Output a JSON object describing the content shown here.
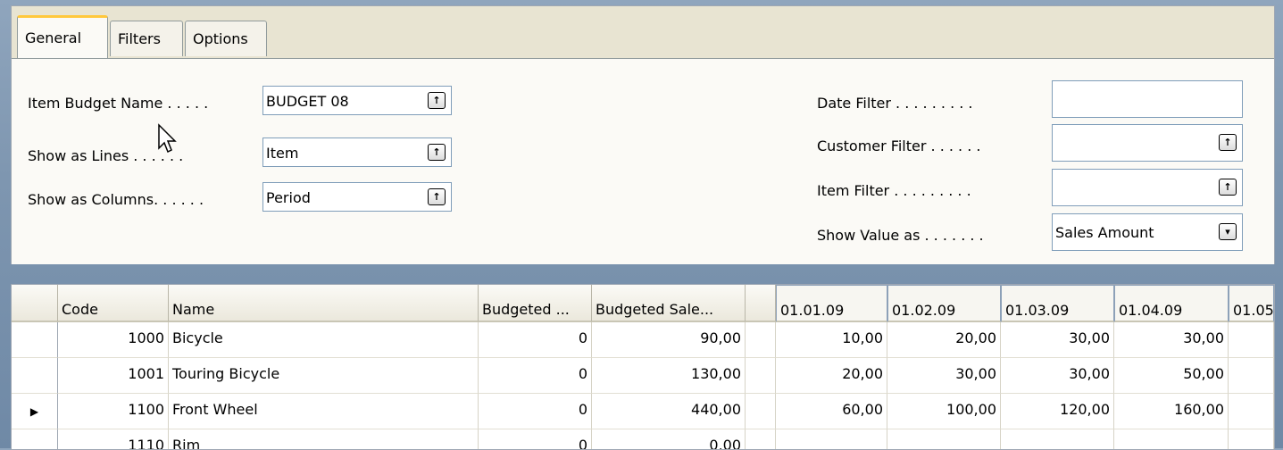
{
  "tabs": [
    "General",
    "Filters",
    "Options"
  ],
  "form": {
    "item_budget_name_label": "Item Budget Name . . . . .",
    "item_budget_name_value": "BUDGET 08",
    "show_as_lines_label": "Show as Lines . . . . . .",
    "show_as_lines_value": "Item",
    "show_as_columns_label": "Show as Columns. . . . . .",
    "show_as_columns_value": "Period",
    "date_filter_label": "Date Filter . . . . . . . . .",
    "date_filter_value": "",
    "customer_filter_label": "Customer Filter . . . . . .",
    "customer_filter_value": "",
    "item_filter_label": "Item Filter . . . . . . . . .",
    "item_filter_value": "",
    "show_value_as_label": "Show Value as . . . . . . .",
    "show_value_as_value": "Sales Amount"
  },
  "icons": {
    "lookup": "arrow-up-lookup-icon",
    "dropdown": "arrow-down-dropdown-icon",
    "row_selector": "triangle-right-icon"
  },
  "table": {
    "columns": [
      "Code",
      "Name",
      "Budgeted ...",
      "Budgeted Sale..."
    ],
    "periods": [
      "01.01.09",
      "01.02.09",
      "01.03.09",
      "01.04.09",
      "01.05"
    ],
    "rows": [
      {
        "code": "1000",
        "name": "Bicycle",
        "qty": "0",
        "sales": "90,00",
        "p1": "10,00",
        "p2": "20,00",
        "p3": "30,00",
        "p4": "30,00",
        "marker": ""
      },
      {
        "code": "1001",
        "name": "Touring Bicycle",
        "qty": "0",
        "sales": "130,00",
        "p1": "20,00",
        "p2": "30,00",
        "p3": "30,00",
        "p4": "50,00",
        "marker": ""
      },
      {
        "code": "1100",
        "name": "Front Wheel",
        "qty": "0",
        "sales": "440,00",
        "p1": "60,00",
        "p2": "100,00",
        "p3": "120,00",
        "p4": "160,00",
        "marker": "▶"
      },
      {
        "code": "1110",
        "name": "Rim",
        "qty": "0",
        "sales": "0,00",
        "p1": "",
        "p2": "",
        "p3": "",
        "p4": "",
        "marker": ""
      }
    ]
  }
}
